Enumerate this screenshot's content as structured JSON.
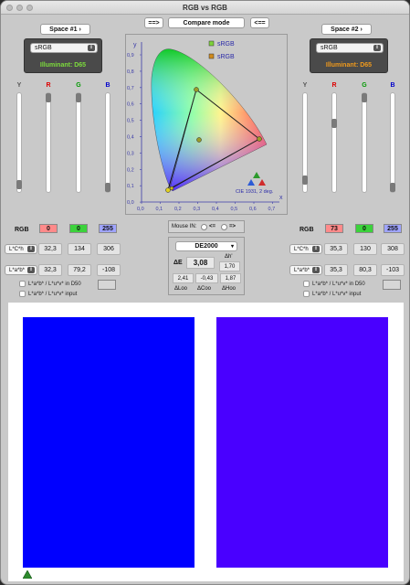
{
  "window": {
    "title": "RGB vs RGB"
  },
  "top": {
    "left_arrow": "==>",
    "compare_mode": "Compare mode",
    "right_arrow": "<=="
  },
  "space1": {
    "button": "Space #1",
    "profile": "sRGB",
    "illuminant": "Illuminant: D65",
    "illuminant_color": "#7ddc3c",
    "sliders": {
      "labels": [
        "Y",
        "R",
        "G",
        "B"
      ],
      "levels": [
        0.03,
        1.0,
        1.0,
        0.0
      ]
    },
    "rgb_label": "RGB",
    "rgb": [
      "0",
      "0",
      "255"
    ],
    "lch_select": "L*C*h",
    "lch": [
      "32,3",
      "134",
      "306"
    ],
    "lab_select": "L*a*b*",
    "lab": [
      "32,3",
      "79,2",
      "-108"
    ],
    "check1": "L*a*b* / L*u*v* in D50",
    "check2": "L*a*b* / L*u*v* input"
  },
  "space2": {
    "button": "Space #2",
    "profile": "sRGB",
    "illuminant": "Illuminant: D65",
    "illuminant_color": "#f09a1c",
    "sliders": {
      "labels": [
        "Y",
        "R",
        "G",
        "B"
      ],
      "levels": [
        0.08,
        0.71,
        1.0,
        0.0
      ]
    },
    "rgb_label": "RGB",
    "rgb": [
      "73",
      "0",
      "255"
    ],
    "lch_select": "L*C*h",
    "lch": [
      "35,3",
      "130",
      "308"
    ],
    "lab_select": "L*a*b*",
    "lab": [
      "35,3",
      "80,3",
      "-103"
    ],
    "check1": "L*a*b* / L*u*v* in D50",
    "check2": "L*a*b* / L*u*v* input"
  },
  "chart": {
    "legend": [
      "sRGB",
      "sRGB"
    ],
    "caption": "CIE 1931, 2 deg.",
    "y_label": "y",
    "x_label": "x",
    "y_ticks": [
      "0,9",
      "0,8",
      "0,7",
      "0,6",
      "0,5",
      "0,4",
      "0,3",
      "0,2",
      "0,1",
      "0,0"
    ],
    "x_ticks": [
      "0,0",
      "0,1",
      "0,2",
      "0,3",
      "0,4",
      "0,5",
      "0,6",
      "0,7"
    ]
  },
  "mouse": {
    "label": "Mouse IN:",
    "left": "<=",
    "right": "=>"
  },
  "delta": {
    "formula": "DE2000",
    "de_label": "ΔE",
    "de_value": "3,08",
    "dh_label": "Δh'",
    "dh_value": "1,70",
    "values": [
      "2,41",
      "-0,43",
      "1,87"
    ],
    "labels": [
      "ΔLoo",
      "ΔCoo",
      "ΔHoo"
    ]
  },
  "swatches": {
    "left_color": "#0000ff",
    "right_color": "#4900ff"
  }
}
